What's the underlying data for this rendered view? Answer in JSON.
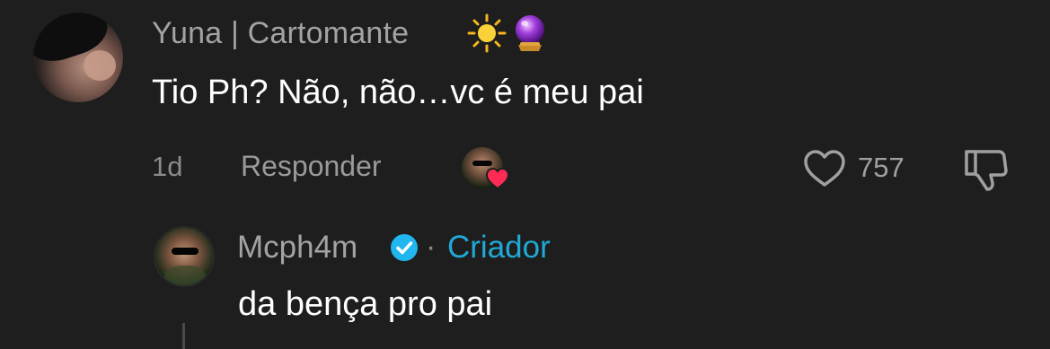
{
  "comment": {
    "username": "Yuna | Cartomante",
    "username_emojis": [
      "sun-emoji",
      "crystal-ball-emoji"
    ],
    "text": "Tio Ph? Não, não…vc é meu pai",
    "time": "1d",
    "reply_label": "Responder",
    "creator_liked": true,
    "like_count": "757"
  },
  "reply": {
    "username": "Mcph4m",
    "verified": true,
    "separator": "·",
    "creator_tag": "Criador",
    "text": "da bença pro pai"
  },
  "colors": {
    "background": "#1e1e1e",
    "creator_tag": "#20a9d6",
    "verified_badge": "#20b7f0",
    "heart": "#fe2c55",
    "secondary_text": "#a3a3a3"
  }
}
